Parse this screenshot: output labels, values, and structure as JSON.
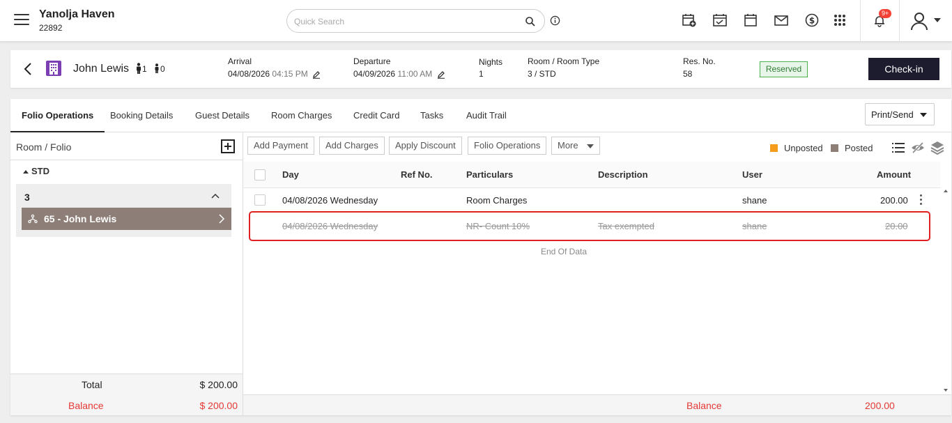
{
  "header": {
    "property_name": "Yanolja Haven",
    "property_id": "22892",
    "search_placeholder": "Quick Search",
    "notification_badge": "9+"
  },
  "reservation": {
    "guest_name": "John Lewis",
    "adults": "1",
    "children": "0",
    "arrival_label": "Arrival",
    "arrival_date": "04/08/2026",
    "arrival_time": "04:15 PM",
    "departure_label": "Departure",
    "departure_date": "04/09/2026",
    "departure_time": "11:00 AM",
    "nights_label": "Nights",
    "nights_value": "1",
    "room_label": "Room / Room Type",
    "room_value": "3 / STD",
    "resno_label": "Res. No.",
    "resno_value": "58",
    "status": "Reserved",
    "checkin_label": "Check-in"
  },
  "tabs": [
    {
      "label": "Folio Operations",
      "active": true
    },
    {
      "label": "Booking Details"
    },
    {
      "label": "Guest Details"
    },
    {
      "label": "Room Charges"
    },
    {
      "label": "Credit Card"
    },
    {
      "label": "Tasks"
    },
    {
      "label": "Audit Trail"
    }
  ],
  "print_send_label": "Print/Send",
  "left_pane": {
    "title": "Room / Folio",
    "group": "STD",
    "room": "3",
    "folio": "65 - John Lewis",
    "total_label": "Total",
    "total_value": "$ 200.00",
    "balance_label": "Balance",
    "balance_value": "$ 200.00"
  },
  "actions": {
    "add_payment": "Add Payment",
    "add_charges": "Add Charges",
    "apply_discount": "Apply Discount",
    "folio_operations": "Folio Operations",
    "more": "More"
  },
  "legend": {
    "unposted": "Unposted",
    "posted": "Posted",
    "unposted_color": "#f59c1a",
    "posted_color": "#8d7f78"
  },
  "table": {
    "headers": {
      "day": "Day",
      "ref": "Ref No.",
      "particulars": "Particulars",
      "description": "Description",
      "user": "User",
      "amount": "Amount"
    },
    "rows": [
      {
        "day": "04/08/2026 Wednesday",
        "ref": "",
        "particulars": "Room Charges",
        "description": "",
        "user": "shane",
        "amount": "200.00"
      },
      {
        "day": "04/08/2026 Wednesday",
        "ref": "",
        "particulars": "NR- Count 10%",
        "description": "Tax exempted",
        "user": "shane",
        "amount": "20.00"
      }
    ],
    "end_text": "End Of Data"
  },
  "footer": {
    "balance_label": "Balance",
    "balance_value": "200.00"
  }
}
